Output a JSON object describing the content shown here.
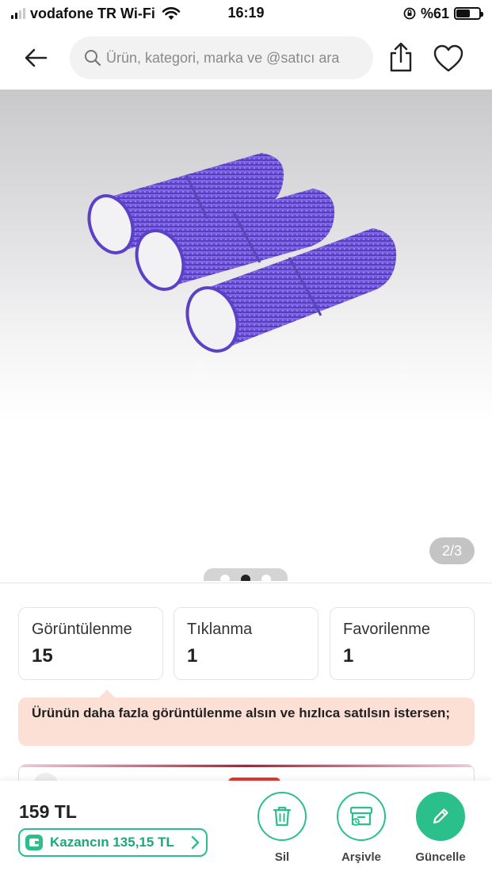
{
  "status_bar": {
    "carrier": "vodafone TR Wi-Fi",
    "time": "16:19",
    "battery": "%61",
    "battery_level": 0.61
  },
  "header": {
    "search_placeholder": "Ürün, kategori, marka ve @satıcı ara",
    "icons": [
      "back-arrow-icon",
      "search-icon",
      "share-icon",
      "heart-icon"
    ]
  },
  "gallery": {
    "page_counter": "2/3",
    "dot_count": 3,
    "active_dot": 2
  },
  "stats": [
    {
      "label": "Görüntülenme",
      "value": "15"
    },
    {
      "label": "Tıklanma",
      "value": "1"
    },
    {
      "label": "Favorilenme",
      "value": "1"
    }
  ],
  "callout": {
    "text": "Ürünün daha fazla görüntülenme alsın ve hızlıca satılsın istersen;"
  },
  "bottom_bar": {
    "price": "159 TL",
    "earnings": "Kazancın 135,15 TL",
    "actions": [
      {
        "label": "Sil",
        "icon": "trash-icon"
      },
      {
        "label": "Arşivle",
        "icon": "archive-icon"
      },
      {
        "label": "Güncelle",
        "icon": "pencil-icon"
      }
    ]
  },
  "colors": {
    "accent_green": "#2bbf8c",
    "callout_bg": "#fde0d5",
    "product_purple": "#6a4fd8"
  }
}
